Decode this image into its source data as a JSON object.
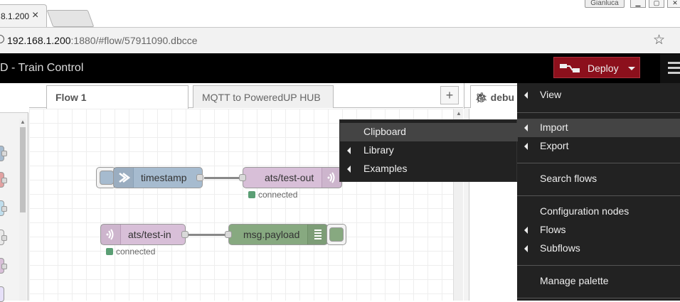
{
  "browser": {
    "tab_title": "8.1.200",
    "tab_close": "×",
    "user": "Gianluca",
    "url_host": "192.168.1.200",
    "url_rest": ":1880/#flow/57911090.dbcce"
  },
  "header": {
    "title": "D - Train Control",
    "deploy_label": "Deploy",
    "colors": {
      "deploy_bg": "#8c101c",
      "header_bg": "#000000"
    }
  },
  "workspace": {
    "tabs": [
      {
        "label": "Flow 1",
        "active": true
      },
      {
        "label": "MQTT to PoweredUP HUB",
        "active": false
      }
    ],
    "add_tab_label": "+"
  },
  "flow": {
    "nodes": [
      {
        "label": "timestamp",
        "type": "inject",
        "color": "#a6bbcf"
      },
      {
        "label": "ats/test-out",
        "type": "mqtt out",
        "color": "#d8bfd8",
        "status": "connected"
      },
      {
        "label": "ats/test-in",
        "type": "mqtt in",
        "color": "#d8bfd8",
        "status": "connected"
      },
      {
        "label": "msg.payload",
        "type": "debug",
        "color": "#87a980"
      }
    ]
  },
  "sidebar": {
    "debug_tab_label": "debu"
  },
  "main_menu": {
    "items": [
      {
        "label": "View",
        "submenu": true
      },
      {
        "label": "Import",
        "submenu": true,
        "highlighted": true
      },
      {
        "label": "Export",
        "submenu": true
      },
      {
        "label": "Search flows",
        "submenu": false
      },
      {
        "label": "Configuration nodes",
        "submenu": false
      },
      {
        "label": "Flows",
        "submenu": true
      },
      {
        "label": "Subflows",
        "submenu": true
      },
      {
        "label": "Manage palette",
        "submenu": false
      }
    ]
  },
  "import_submenu": {
    "items": [
      {
        "label": "Clipboard",
        "submenu": false,
        "highlighted": true
      },
      {
        "label": "Library",
        "submenu": true
      },
      {
        "label": "Examples",
        "submenu": true
      }
    ]
  }
}
